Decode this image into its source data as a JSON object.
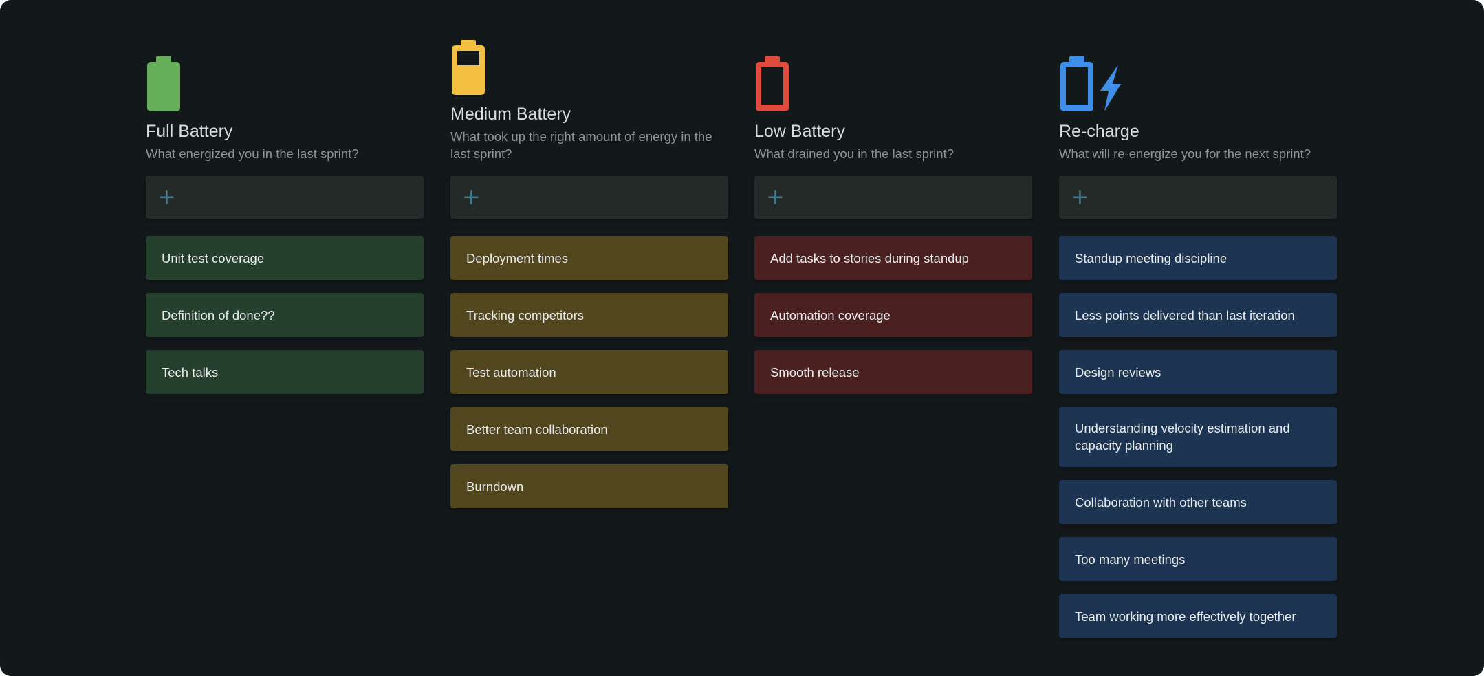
{
  "colors": {
    "background": "#13181b",
    "full_accent": "#66ae59",
    "medium_accent": "#f4c042",
    "low_accent": "#df4c3d",
    "recharge_accent": "#3f8ee8",
    "add_plus": "#3f7a8e"
  },
  "columns": [
    {
      "icon": "battery-full-icon",
      "title": "Full Battery",
      "subtitle": "What energized you in the last sprint?",
      "add_label": "+",
      "cards": [
        "Unit test coverage",
        "Definition of done??",
        "Tech talks"
      ]
    },
    {
      "icon": "battery-medium-icon",
      "title": "Medium Battery",
      "subtitle": "What took up the right amount of energy in the last sprint?",
      "add_label": "+",
      "cards": [
        "Deployment times",
        "Tracking competitors",
        "Test automation",
        "Better team collaboration",
        "Burndown"
      ]
    },
    {
      "icon": "battery-low-icon",
      "title": "Low Battery",
      "subtitle": "What drained you in the last sprint?",
      "add_label": "+",
      "cards": [
        "Add tasks to stories during standup",
        "Automation coverage",
        "Smooth release"
      ]
    },
    {
      "icon": "battery-recharge-icon",
      "title": "Re-charge",
      "subtitle": "What will re-energize you for the next sprint?",
      "add_label": "+",
      "cards": [
        "Standup meeting discipline",
        "Less points delivered than last iteration",
        "Design reviews",
        "Understanding velocity estimation and capacity planning",
        "Collaboration with other teams",
        "Too many meetings",
        "Team working more effectively together"
      ]
    }
  ]
}
